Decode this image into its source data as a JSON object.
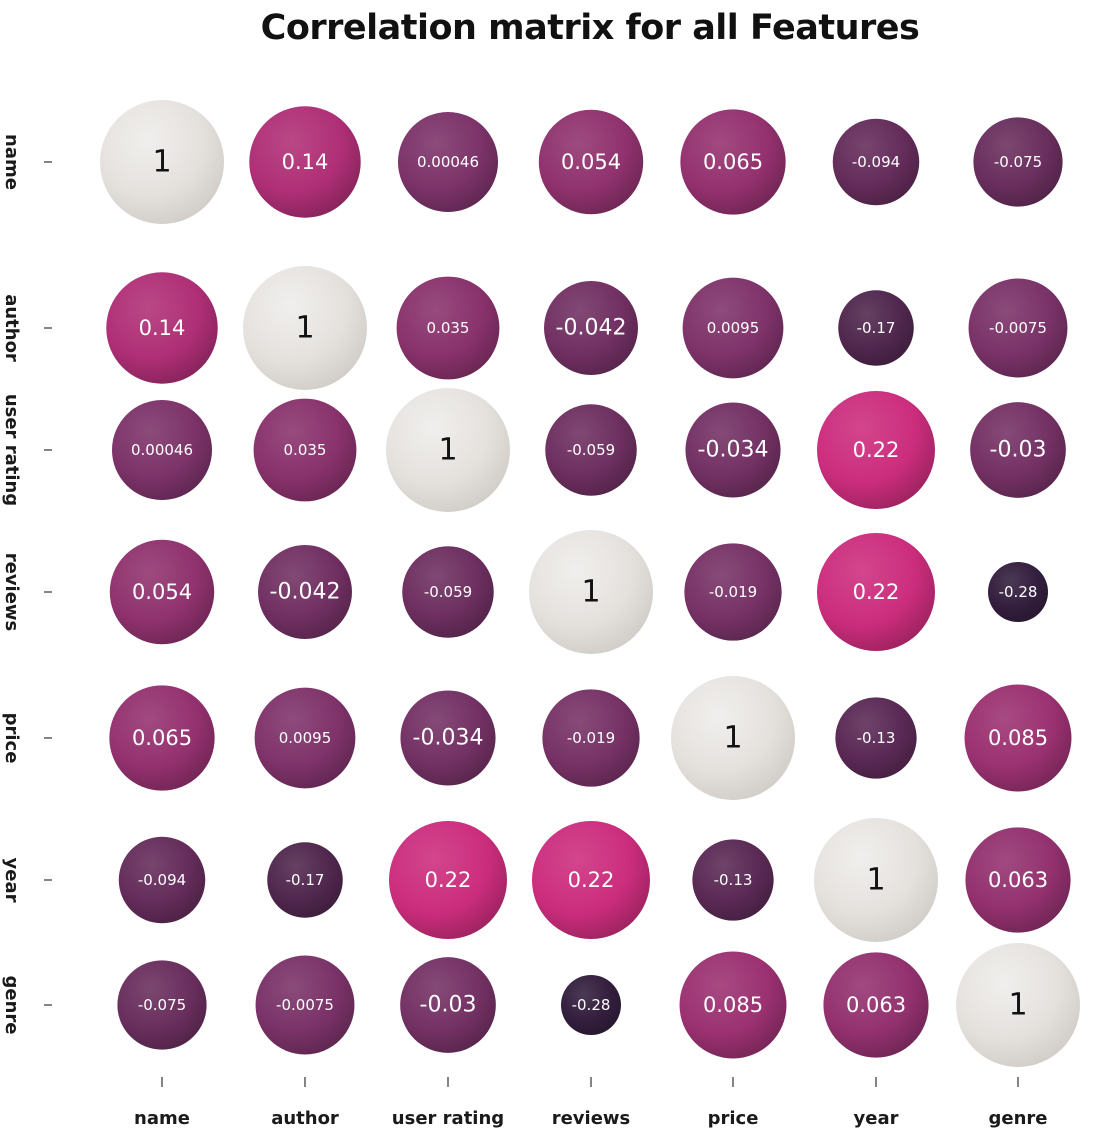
{
  "chart_data": {
    "type": "heatmap",
    "title": "Correlation matrix for all Features",
    "xlabel": "",
    "ylabel": "",
    "categories": [
      "name",
      "author",
      "user rating",
      "reviews",
      "price",
      "year",
      "genre"
    ],
    "matrix": [
      [
        1,
        0.14,
        0.00046,
        0.054,
        0.065,
        -0.094,
        -0.075
      ],
      [
        0.14,
        1,
        0.035,
        -0.042,
        0.0095,
        -0.17,
        -0.0075
      ],
      [
        0.00046,
        0.035,
        1,
        -0.059,
        -0.034,
        0.22,
        -0.03
      ],
      [
        0.054,
        -0.042,
        -0.059,
        1,
        -0.019,
        0.22,
        -0.28
      ],
      [
        0.065,
        0.0095,
        -0.034,
        -0.019,
        1,
        -0.13,
        0.085
      ],
      [
        -0.094,
        -0.17,
        0.22,
        0.22,
        -0.13,
        1,
        0.063
      ],
      [
        -0.075,
        -0.0075,
        -0.03,
        -0.28,
        0.085,
        0.063,
        1
      ]
    ],
    "grid": false,
    "colors": {
      "diagonal": "#e4e1dd",
      "strong_positive": "#cc2d7d",
      "mid": "#7c3369",
      "negative": "#2e1d3a"
    }
  }
}
